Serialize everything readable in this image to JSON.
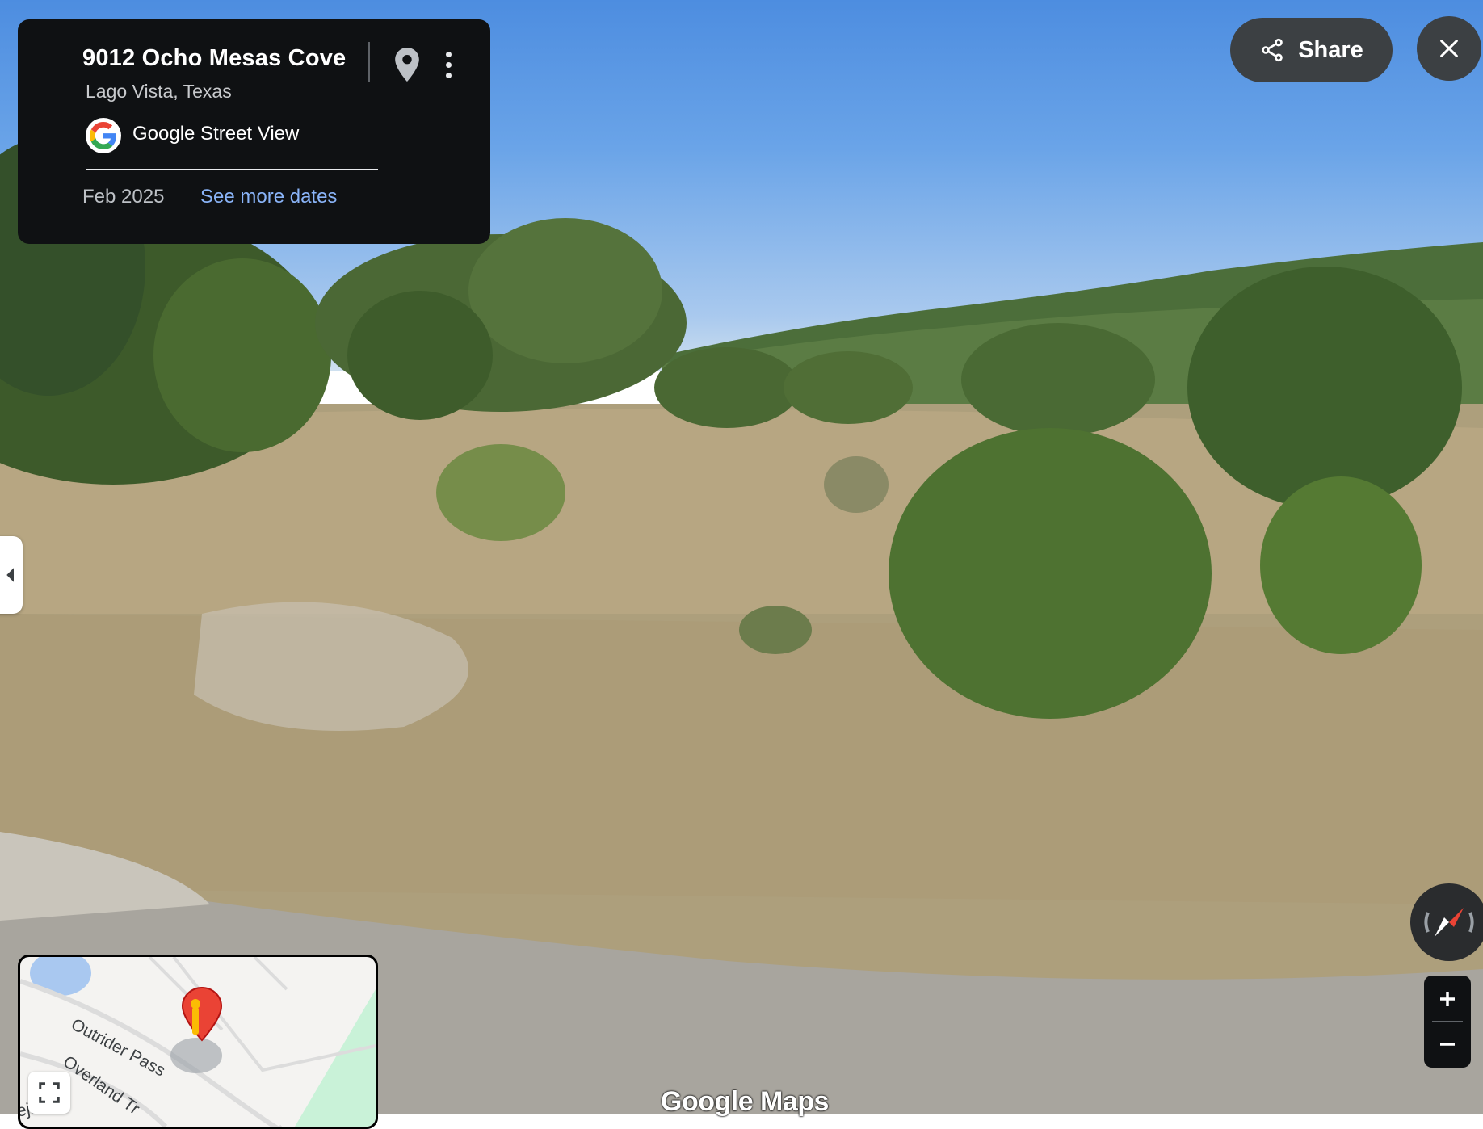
{
  "location": {
    "title": "9012 Ocho Mesas Cove",
    "subtitle": "Lago Vista, Texas"
  },
  "provider": {
    "name": "Google Street View",
    "logo_icon": "google-g-icon"
  },
  "imagery": {
    "date": "Feb 2025",
    "more_dates_label": "See more dates"
  },
  "toolbar": {
    "share_label": "Share",
    "share_icon": "share-icon",
    "close_icon": "close-icon",
    "pin_icon": "map-pin-icon",
    "more_icon": "more-vert-icon"
  },
  "zoom": {
    "in_label": "+",
    "out_label": "−"
  },
  "minimap": {
    "streets": [
      "Outrider Pass",
      "Overland Tr",
      "ejas"
    ]
  },
  "watermark": "Google Maps",
  "colors": {
    "panel_bg": "#0f1113",
    "link": "#8ab4f8",
    "button_bg": "#3c4043",
    "pin_red": "#ea4335"
  }
}
